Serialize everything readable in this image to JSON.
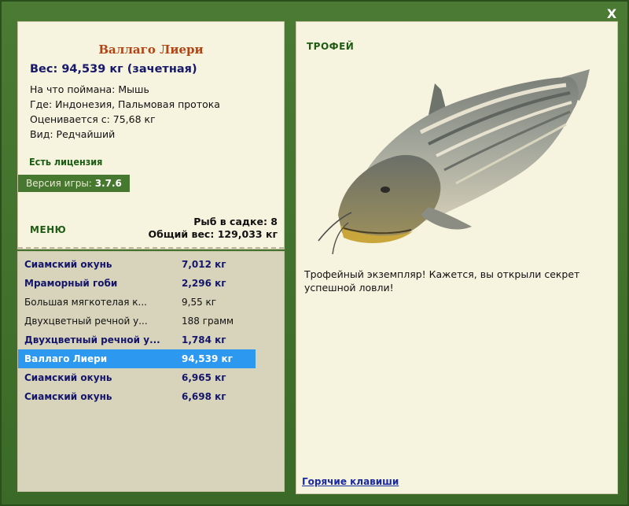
{
  "window": {
    "close_label": "X"
  },
  "catch": {
    "title": "Валлаго Лиери",
    "weight_line": "Вес: 94,539 кг (зачетная)",
    "details": [
      "На что поймана: Мышь",
      "Где: Индонезия, Пальмовая протока",
      "Оценивается с: 75,68 кг",
      "Вид: Редчайший"
    ],
    "license": "Есть лицензия",
    "version_label": "Версия игры:",
    "version_value": "3.7.6"
  },
  "menu_label": "МЕНЮ",
  "keepnet": {
    "count_line": "Рыб в садке: 8",
    "total_line": "Общий вес: 129,033 кг"
  },
  "fish_list": [
    {
      "name": "Сиамский окунь",
      "weight": "7,012 кг",
      "bold": true,
      "selected": false
    },
    {
      "name": "Мраморный гоби",
      "weight": "2,296 кг",
      "bold": true,
      "selected": false
    },
    {
      "name": "Большая мягкотелая к...",
      "weight": "9,55 кг",
      "bold": false,
      "selected": false
    },
    {
      "name": "Двухцветный речной у...",
      "weight": "188 грамм",
      "bold": false,
      "selected": false
    },
    {
      "name": "Двухцветный речной у...",
      "weight": "1,784 кг",
      "bold": true,
      "selected": false
    },
    {
      "name": "Валлаго Лиери",
      "weight": "94,539 кг",
      "bold": true,
      "selected": true
    },
    {
      "name": "Сиамский окунь",
      "weight": "6,965 кг",
      "bold": true,
      "selected": false
    },
    {
      "name": "Сиамский окунь",
      "weight": "6,698 кг",
      "bold": true,
      "selected": false
    }
  ],
  "trophy": {
    "label": "ТРОФЕЙ",
    "text": "Трофейный экземпляр! Кажется, вы открыли секрет успешной ловли!",
    "hotkeys_link": "Горячие клавиши"
  },
  "colors": {
    "frame_green": "#3d6b29",
    "panel_bg": "#f6f3df",
    "list_bg": "#d8d4bb",
    "title_red": "#b24414",
    "selected_blue": "#2c98f0",
    "bold_navy": "#14156b"
  }
}
